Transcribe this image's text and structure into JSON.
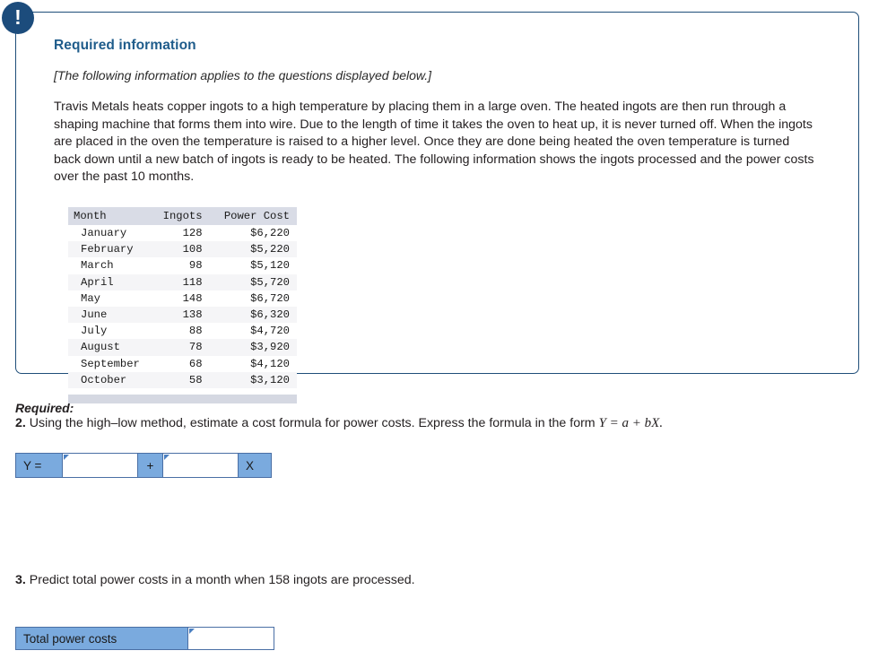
{
  "card": {
    "alert_icon": "exclamation-icon",
    "alert_glyph": "!",
    "title": "Required information",
    "italic_note": "[The following information applies to the questions displayed below.]",
    "body": "Travis Metals heats copper ingots to a high temperature by placing them in a large oven. The heated ingots are then run through a shaping machine that forms them into wire. Due to the length of time it takes the oven to heat up, it is never turned off. When the ingots are placed in the oven the temperature is raised to a higher level. Once they are done being heated the oven temperature is turned back down until a new batch of ingots is ready to be heated. The following information shows the ingots processed and the power costs over the past 10 months."
  },
  "table": {
    "headers": [
      "Month",
      "Ingots",
      "Power Cost"
    ],
    "rows": [
      {
        "month": "January",
        "ingots": "128",
        "cost": "$6,220"
      },
      {
        "month": "February",
        "ingots": "108",
        "cost": "$5,220"
      },
      {
        "month": "March",
        "ingots": "98",
        "cost": "$5,120"
      },
      {
        "month": "April",
        "ingots": "118",
        "cost": "$5,720"
      },
      {
        "month": "May",
        "ingots": "148",
        "cost": "$6,720"
      },
      {
        "month": "June",
        "ingots": "138",
        "cost": "$6,320"
      },
      {
        "month": "July",
        "ingots": "88",
        "cost": "$4,720"
      },
      {
        "month": "August",
        "ingots": "78",
        "cost": "$3,920"
      },
      {
        "month": "September",
        "ingots": "68",
        "cost": "$4,120"
      },
      {
        "month": "October",
        "ingots": "58",
        "cost": "$3,120"
      }
    ]
  },
  "questions": {
    "required_label": "Required:",
    "q2_number": "2.",
    "q2_text": " Using the high–low method, estimate a cost formula for power costs. Express the formula in the form ",
    "q2_formula": "Y = a + bX.",
    "q3_number": "3.",
    "q3_text": " Predict total power costs in a month when 158 ingots are processed."
  },
  "answers": {
    "row2": {
      "y_label": "Y =",
      "intercept_value": "",
      "intercept_placeholder": "",
      "operator": "+",
      "slope_value": "",
      "slope_placeholder": "",
      "x_label": "X"
    },
    "row3": {
      "label": "Total power costs",
      "value": "",
      "placeholder": ""
    }
  },
  "colors": {
    "card_border": "#1f4e79",
    "badge": "#1c4c7c",
    "title_blue": "#1f5c8b",
    "cell_blue": "#7aaade",
    "cell_border": "#4a6fa5",
    "table_header": "#d9dce6",
    "table_alt_row": "#f5f5f7",
    "table_footer": "#d5d8e2"
  }
}
